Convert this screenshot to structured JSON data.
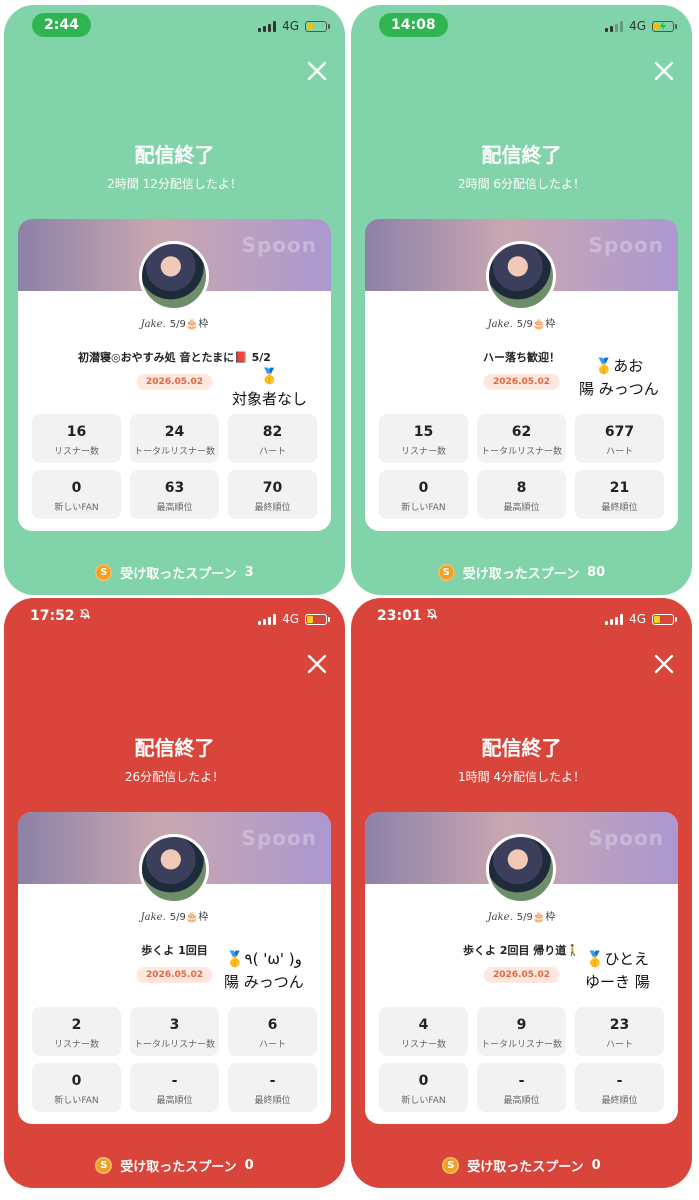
{
  "panels": [
    {
      "theme": "green",
      "status_time": "2:44",
      "network": "4G",
      "battery_color": "#f2c200",
      "title": "配信終了",
      "subtitle": "2時間 12分配信したよ！",
      "watermark": "Spoon",
      "dj_name": "Jake.",
      "dj_tag": "5/9🎂枠",
      "live_title": "初潜寝◎おやすみ処 音とたまに📕 5/2",
      "date": "2026.05.02",
      "handwritten": "🥇\n対象者なし",
      "stats": [
        {
          "value": "16",
          "label": "リスナー数"
        },
        {
          "value": "24",
          "label": "トータルリスナー数"
        },
        {
          "value": "82",
          "label": "ハート"
        },
        {
          "value": "0",
          "label": "新しいFAN"
        },
        {
          "value": "63",
          "label": "最高順位"
        },
        {
          "value": "70",
          "label": "最終順位"
        }
      ],
      "spoon_label": "受け取ったスプーン",
      "spoon_count": "3"
    },
    {
      "theme": "green",
      "status_time": "14:08",
      "network": "4G",
      "battery_color": "#f2c200",
      "title": "配信終了",
      "subtitle": "2時間 6分配信したよ！",
      "watermark": "Spoon",
      "dj_name": "Jake.",
      "dj_tag": "5/9🎂枠",
      "live_title": "ハー落ち歓迎！",
      "date": "2026.05.02",
      "handwritten": "🥇あお\n陽 みっつん",
      "stats": [
        {
          "value": "15",
          "label": "リスナー数"
        },
        {
          "value": "62",
          "label": "トータルリスナー数"
        },
        {
          "value": "677",
          "label": "ハート"
        },
        {
          "value": "0",
          "label": "新しいFAN"
        },
        {
          "value": "8",
          "label": "最高順位"
        },
        {
          "value": "21",
          "label": "最終順位"
        }
      ],
      "spoon_label": "受け取ったスプーン",
      "spoon_count": "80"
    },
    {
      "theme": "red",
      "status_time": "17:52",
      "network": "4G",
      "battery_color": "#f2c200",
      "title": "配信終了",
      "subtitle": "26分配信したよ！",
      "watermark": "Spoon",
      "dj_name": "Jake.",
      "dj_tag": "5/9🎂枠",
      "live_title": "歩くよ 1回目",
      "date": "2026.05.02",
      "handwritten": "🥇٩( 'ω' )و\n陽 みっつん",
      "stats": [
        {
          "value": "2",
          "label": "リスナー数"
        },
        {
          "value": "3",
          "label": "トータルリスナー数"
        },
        {
          "value": "6",
          "label": "ハート"
        },
        {
          "value": "0",
          "label": "新しいFAN"
        },
        {
          "value": "-",
          "label": "最高順位"
        },
        {
          "value": "-",
          "label": "最終順位"
        }
      ],
      "spoon_label": "受け取ったスプーン",
      "spoon_count": "0"
    },
    {
      "theme": "red",
      "status_time": "23:01",
      "network": "4G",
      "battery_color": "#f2c200",
      "title": "配信終了",
      "subtitle": "1時間 4分配信したよ！",
      "watermark": "Spoon",
      "dj_name": "Jake.",
      "dj_tag": "5/9🎂枠",
      "live_title": "歩くよ 2回目 帰り道🚶",
      "date": "2026.05.02",
      "handwritten": "🥇ひとえ\nゆーき 陽",
      "stats": [
        {
          "value": "4",
          "label": "リスナー数"
        },
        {
          "value": "9",
          "label": "トータルリスナー数"
        },
        {
          "value": "23",
          "label": "ハート"
        },
        {
          "value": "0",
          "label": "新しいFAN"
        },
        {
          "value": "-",
          "label": "最高順位"
        },
        {
          "value": "-",
          "label": "最終順位"
        }
      ],
      "spoon_label": "受け取ったスプーン",
      "spoon_count": "0"
    }
  ]
}
